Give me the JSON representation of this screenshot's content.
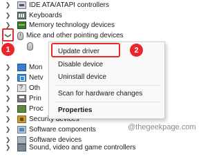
{
  "device_tree": {
    "categories": [
      {
        "label": "IDE ATA/ATAPI controllers",
        "expanded": false,
        "icon": "ide-controller-icon"
      },
      {
        "label": "Keyboards",
        "expanded": false,
        "icon": "keyboard-icon"
      },
      {
        "label": "Memory technology devices",
        "expanded": false,
        "icon": "memory-icon"
      },
      {
        "label": "Mice and other pointing devices",
        "expanded": true,
        "icon": "mouse-icon"
      },
      {
        "label": "",
        "expanded": false,
        "icon": "mouse-icon",
        "child": true
      },
      {
        "label": "Mon",
        "expanded": false,
        "icon": "monitor-icon"
      },
      {
        "label": "Netv",
        "expanded": false,
        "icon": "network-adapter-icon"
      },
      {
        "label": "Oth",
        "expanded": false,
        "icon": "other-devices-icon"
      },
      {
        "label": "Prin",
        "expanded": false,
        "icon": "printer-icon"
      },
      {
        "label": "Proc",
        "expanded": false,
        "icon": "processor-icon"
      },
      {
        "label": "Security devices",
        "expanded": false,
        "icon": "security-device-icon"
      },
      {
        "label": "Software components",
        "expanded": false,
        "icon": "software-component-icon"
      },
      {
        "label": "Software devices",
        "expanded": false,
        "icon": "software-device-icon"
      },
      {
        "label": "Sound, video and game controllers",
        "expanded": false,
        "icon": "sound-icon"
      }
    ]
  },
  "context_menu": {
    "update_driver": "Update driver",
    "disable_device": "Disable device",
    "uninstall_device": "Uninstall device",
    "scan_hardware": "Scan for hardware changes",
    "properties": "Properties"
  },
  "annotations": {
    "step1": "1",
    "step2": "2",
    "highlight_color": "#e8262c"
  },
  "watermark": "@thegeekpage.com"
}
